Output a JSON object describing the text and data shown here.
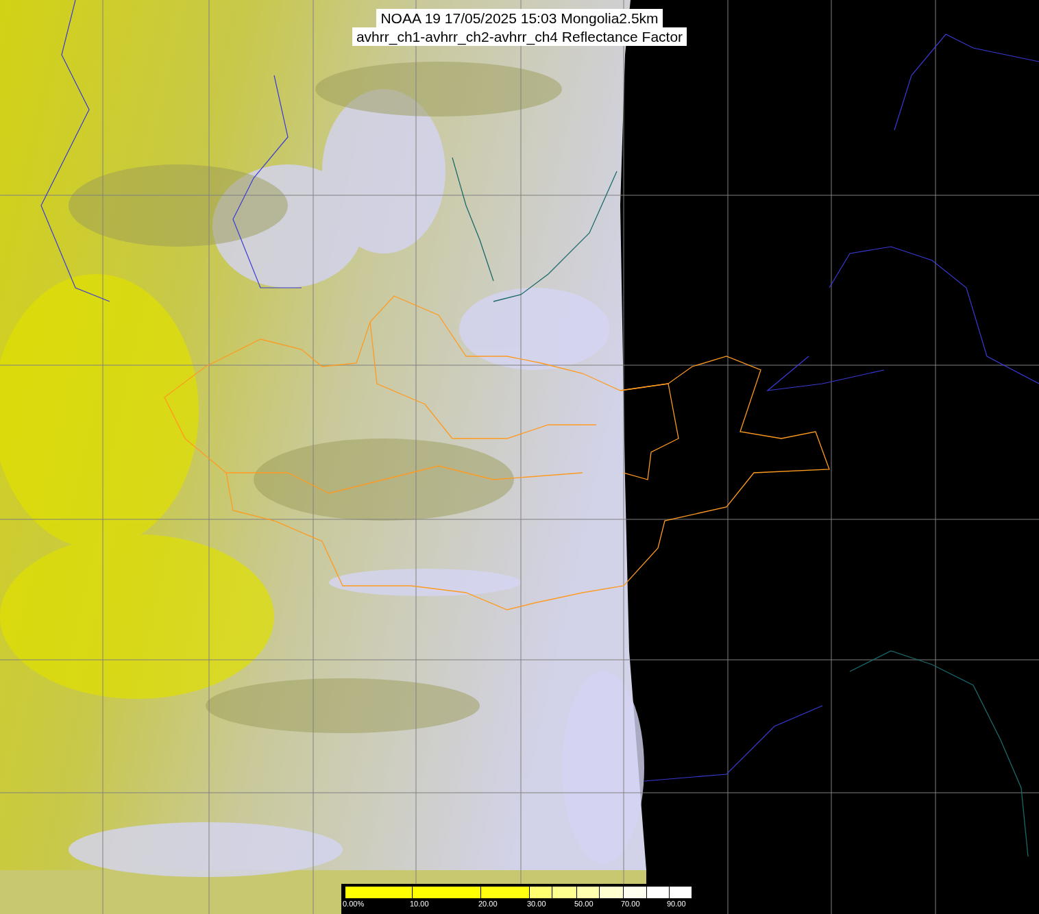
{
  "title": {
    "lines": [
      "NOAA 19 17/05/2025 15:03 Mongolia2.5km",
      "avhrr_ch1-avhrr_ch2-avhrr_ch4 Reflectance Factor"
    ]
  },
  "colorbar": {
    "segments": [
      {
        "color": "#ffff00",
        "label": "0.00%"
      },
      {
        "color": "#ffff00",
        "label": "10.00"
      },
      {
        "color": "#ffff10",
        "label": "20.00"
      },
      {
        "color": "#ffff70",
        "label": "30.00"
      },
      {
        "color": "#ffff90"
      },
      {
        "color": "#ffffb0",
        "label": "50.00"
      },
      {
        "color": "#ffffd0"
      },
      {
        "color": "#fffff0",
        "label": "70.00"
      },
      {
        "color": "#ffffff"
      },
      {
        "color": "#ffffff",
        "label": "90.00"
      }
    ]
  }
}
